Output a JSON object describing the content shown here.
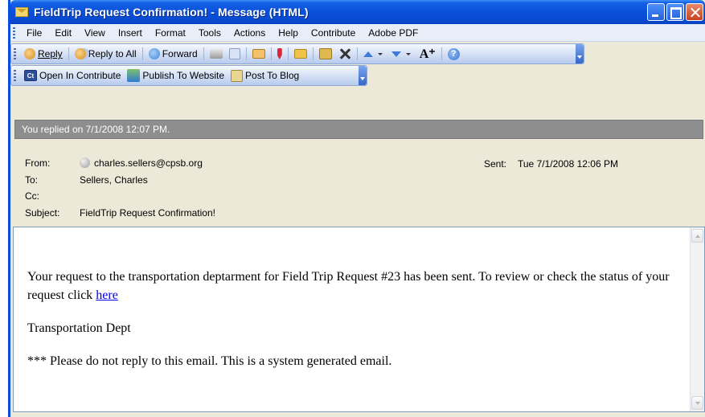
{
  "window": {
    "title": "FieldTrip Request Confirmation! - Message (HTML)"
  },
  "menu": [
    "File",
    "Edit",
    "View",
    "Insert",
    "Format",
    "Tools",
    "Actions",
    "Help",
    "Contribute",
    "Adobe PDF"
  ],
  "toolbar": {
    "reply": "Reply",
    "reply_all": "Reply to All",
    "forward": "Forward",
    "font_icon": "A⁺",
    "help_icon": "?"
  },
  "contribute_toolbar": {
    "contribute_badge": "Ct",
    "open_in_contribute": "Open In Contribute",
    "publish_to_website": "Publish To Website",
    "post_to_blog": "Post To Blog"
  },
  "infobar": "You replied on 7/1/2008 12:07 PM.",
  "header": {
    "from_label": "From:",
    "from": "charles.sellers@cpsb.org",
    "to_label": "To:",
    "to": "Sellers, Charles",
    "cc_label": "Cc:",
    "cc": "",
    "subject_label": "Subject:",
    "subject": "FieldTrip Request Confirmation!",
    "sent_label": "Sent:",
    "sent": "Tue 7/1/2008 12:06 PM"
  },
  "body": {
    "paragraph1": "Your request to the transportation deptarment for Field Trip Request #23 has been sent. To review or check the status of your request click ",
    "link": "here",
    "signature": "Transportation Dept",
    "notice": "*** Please do not reply to this email. This is a system generated email."
  }
}
